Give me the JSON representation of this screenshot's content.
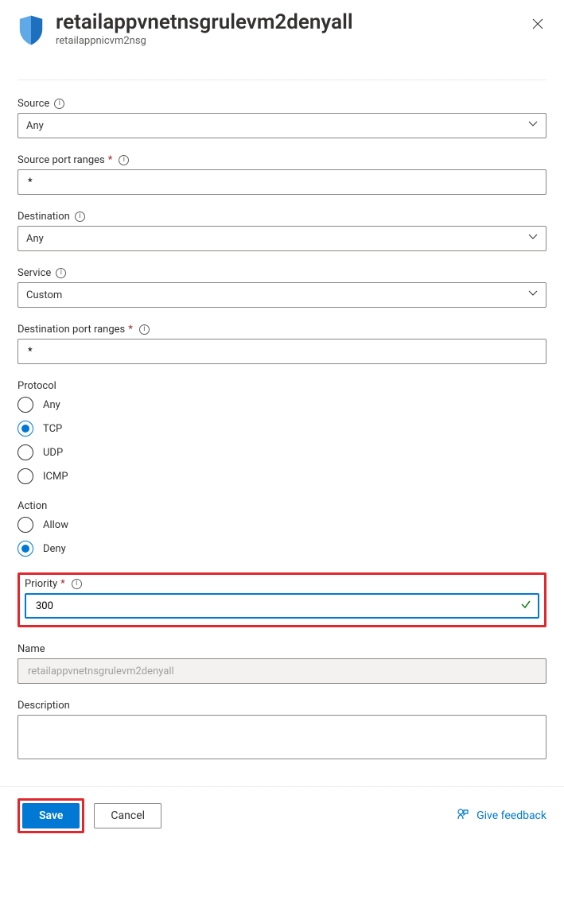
{
  "header": {
    "title": "retailappvnetnsgrulevm2denyall",
    "subtitle": "retailappnicvm2nsg"
  },
  "fields": {
    "source": {
      "label": "Source",
      "value": "Any"
    },
    "sourcePortRanges": {
      "label": "Source port ranges",
      "value": "*"
    },
    "destination": {
      "label": "Destination",
      "value": "Any"
    },
    "service": {
      "label": "Service",
      "value": "Custom"
    },
    "destPortRanges": {
      "label": "Destination port ranges",
      "value": "*"
    },
    "protocol": {
      "label": "Protocol",
      "options": {
        "any": "Any",
        "tcp": "TCP",
        "udp": "UDP",
        "icmp": "ICMP"
      },
      "selected": "tcp"
    },
    "action": {
      "label": "Action",
      "options": {
        "allow": "Allow",
        "deny": "Deny"
      },
      "selected": "deny"
    },
    "priority": {
      "label": "Priority",
      "value": "300"
    },
    "name": {
      "label": "Name",
      "value": "retailappvnetnsgrulevm2denyall"
    },
    "description": {
      "label": "Description",
      "value": ""
    }
  },
  "footer": {
    "save": "Save",
    "cancel": "Cancel",
    "feedback": "Give feedback"
  }
}
